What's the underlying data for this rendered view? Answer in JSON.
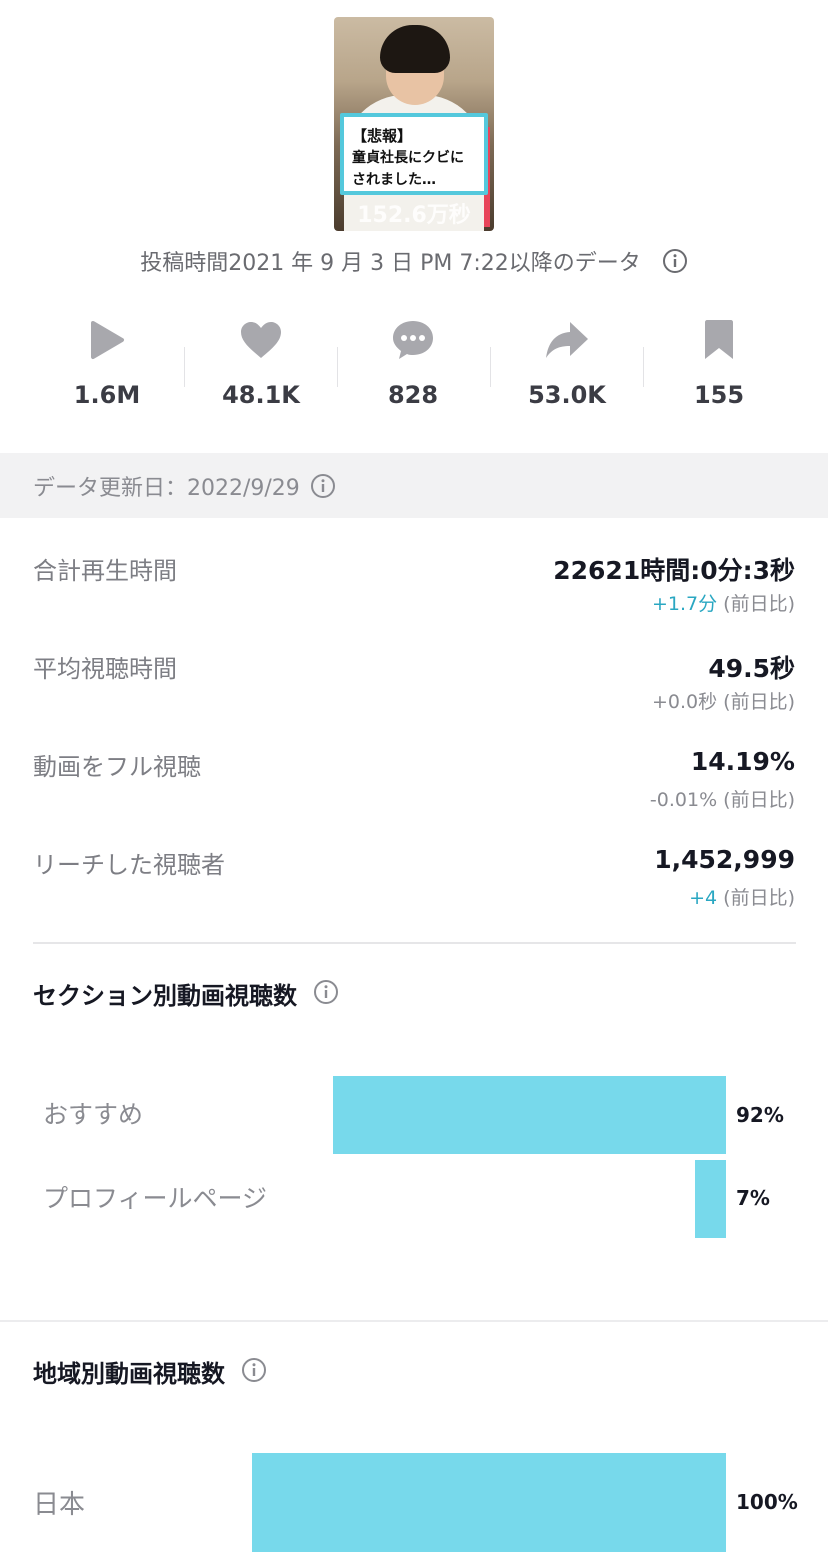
{
  "thumbnail": {
    "caption_line1": "【悲報】",
    "caption_line2": "童貞社長にクビに",
    "caption_line3": "されました…",
    "overlay_text": "152.6万秒"
  },
  "posted_text": "投稿時間2021 年 9 月 3 日 PM 7:22以降のデータ",
  "stats": [
    {
      "icon": "play-icon",
      "value": "1.6M"
    },
    {
      "icon": "heart-icon",
      "value": "48.1K"
    },
    {
      "icon": "comment-icon",
      "value": "828"
    },
    {
      "icon": "share-icon",
      "value": "53.0K"
    },
    {
      "icon": "bookmark-icon",
      "value": "155"
    }
  ],
  "data_updated": "データ更新日：2022/9/29",
  "metrics": [
    {
      "label": "合計再生時間",
      "value": "22621時間:0分:3秒",
      "diff": "+1.7分",
      "diff_suffix": " (前日比)",
      "diff_color": "#2aa7c2"
    },
    {
      "label": "平均視聴時間",
      "value": "49.5秒",
      "diff": "+0.0秒",
      "diff_suffix": " (前日比)",
      "diff_color": "#8a8b91"
    },
    {
      "label": "動画をフル視聴",
      "value": "14.19%",
      "diff": "-0.01%",
      "diff_suffix": " (前日比)",
      "diff_color": "#8a8b91"
    },
    {
      "label": "リーチした視聴者",
      "value": "1,452,999",
      "diff": "+4",
      "diff_suffix": " (前日比)",
      "diff_color": "#2aa7c2"
    }
  ],
  "sections": {
    "title": "セクション別動画視聴数",
    "items": [
      {
        "label": "おすすめ",
        "percent": 92,
        "display": "92%"
      },
      {
        "label": "プロフィールページ",
        "percent": 7,
        "display": "7%"
      }
    ]
  },
  "regions": {
    "title": "地域別動画視聴数",
    "items": [
      {
        "label": "日本",
        "percent": 100,
        "display": "100%"
      }
    ]
  },
  "colors": {
    "bar": "#77d9eb",
    "positive_diff": "#2aa7c2"
  }
}
